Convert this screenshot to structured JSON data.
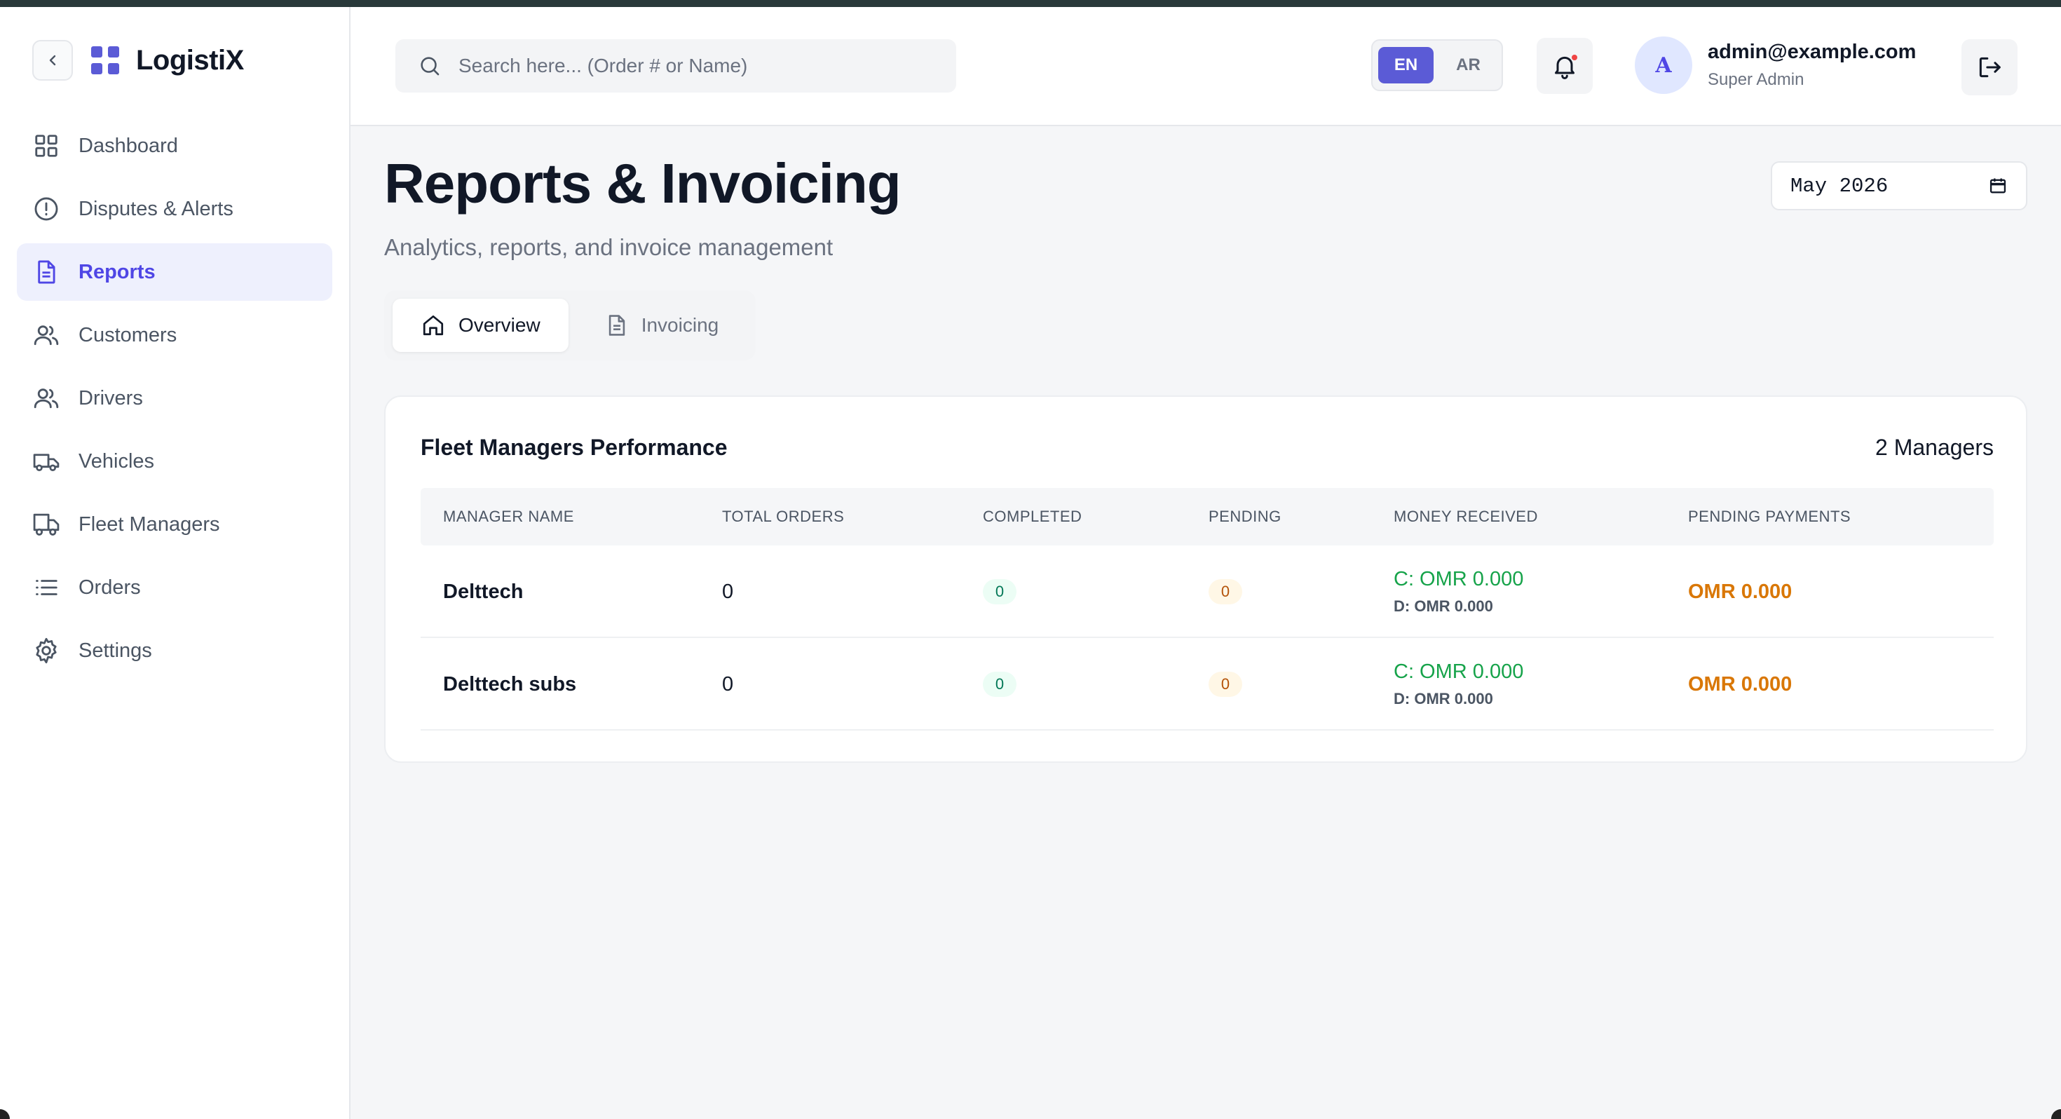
{
  "app": {
    "name": "LogistiX"
  },
  "sidebar": {
    "items": [
      {
        "label": "Dashboard",
        "icon": "grid-icon",
        "active": false
      },
      {
        "label": "Disputes & Alerts",
        "icon": "alert-circle-icon",
        "active": false
      },
      {
        "label": "Reports",
        "icon": "document-icon",
        "active": true
      },
      {
        "label": "Customers",
        "icon": "users-icon",
        "active": false
      },
      {
        "label": "Drivers",
        "icon": "users-icon",
        "active": false
      },
      {
        "label": "Vehicles",
        "icon": "truck-icon",
        "active": false
      },
      {
        "label": "Fleet Managers",
        "icon": "truck-icon",
        "active": false
      },
      {
        "label": "Orders",
        "icon": "list-icon",
        "active": false
      },
      {
        "label": "Settings",
        "icon": "gear-icon",
        "active": false
      }
    ]
  },
  "header": {
    "search_placeholder": "Search here... (Order # or Name)",
    "lang": {
      "en": "EN",
      "ar": "AR",
      "selected": "EN"
    },
    "user": {
      "avatar_letter": "A",
      "email": "admin@example.com",
      "role": "Super Admin"
    }
  },
  "page": {
    "title": "Reports & Invoicing",
    "subtitle": "Analytics, reports, and invoice management",
    "month": "May 2026",
    "tabs": [
      {
        "label": "Overview",
        "active": true
      },
      {
        "label": "Invoicing",
        "active": false
      }
    ]
  },
  "card": {
    "title": "Fleet Managers Performance",
    "count": "2 Managers",
    "columns": [
      "MANAGER NAME",
      "TOTAL ORDERS",
      "COMPLETED",
      "PENDING",
      "MONEY RECEIVED",
      "PENDING PAYMENTS"
    ],
    "rows": [
      {
        "name": "Delttech",
        "total": "0",
        "completed": "0",
        "pending": "0",
        "money_c": "C: OMR 0.000",
        "money_d": "D: OMR 0.000",
        "pending_payments": "OMR 0.000"
      },
      {
        "name": "Delttech subs",
        "total": "0",
        "completed": "0",
        "pending": "0",
        "money_c": "C: OMR 0.000",
        "money_d": "D: OMR 0.000",
        "pending_payments": "OMR 0.000"
      }
    ]
  },
  "colors": {
    "accent": "#5b5bd6",
    "success": "#16a34a",
    "warning": "#d97706"
  }
}
